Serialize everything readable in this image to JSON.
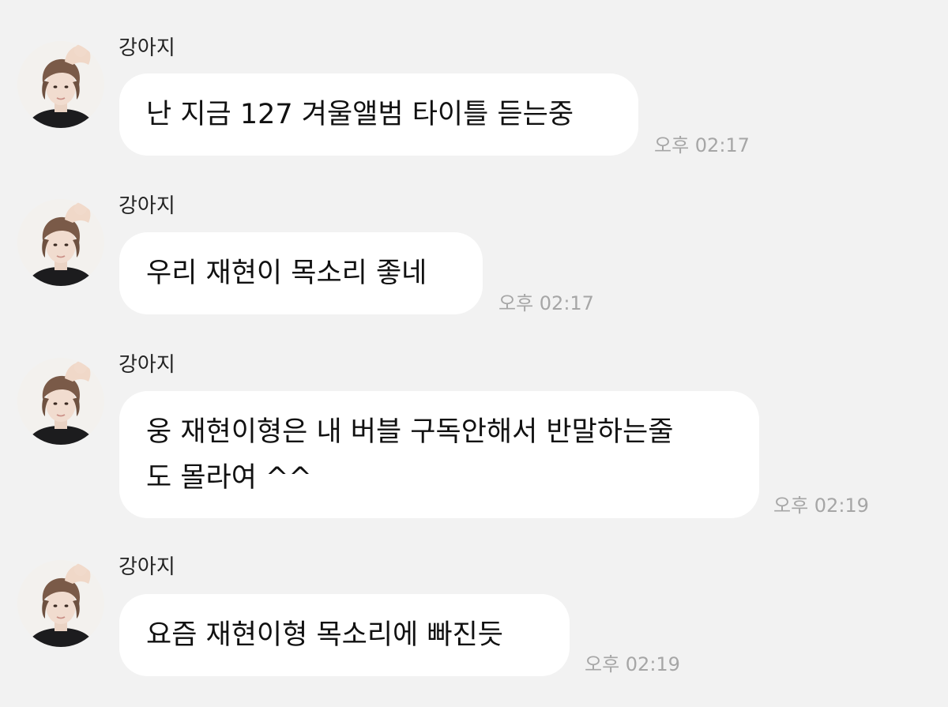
{
  "messages": [
    {
      "sender": "강아지",
      "lines": [
        "난 지금 127 겨울앨범 타이틀 듣는중"
      ],
      "time": "오후 02:17"
    },
    {
      "sender": "강아지",
      "lines": [
        "우리 재현이 목소리 좋네"
      ],
      "time": "오후 02:17"
    },
    {
      "sender": "강아지",
      "lines": [
        "웅 재현이형은 내 버블 구독안해서 반말하는줄",
        "도 몰라여 ^^"
      ],
      "time": "오후 02:19"
    },
    {
      "sender": "강아지",
      "lines": [
        "요즘 재현이형 목소리에 빠진듯"
      ],
      "time": "오후 02:19"
    }
  ],
  "colors": {
    "background": "#f2f2f2",
    "bubble": "#ffffff",
    "timestamp": "#a6a6a6"
  },
  "icons": {
    "avatar": "profile-photo"
  }
}
